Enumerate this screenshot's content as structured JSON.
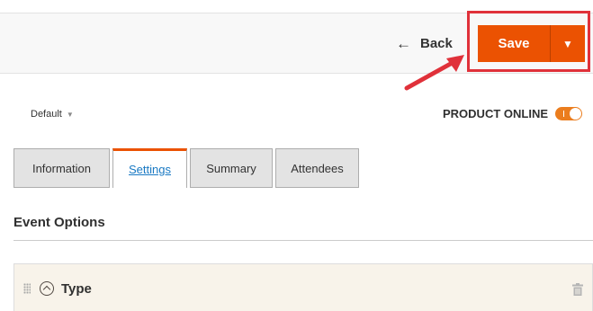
{
  "header": {
    "back_label": "Back",
    "save_label": "Save",
    "save_menu_icon": "caret-down-icon",
    "accent_color": "#eb5202",
    "highlight_color": "#e0313a"
  },
  "store": {
    "scope_label": "Default"
  },
  "status": {
    "online_label": "PRODUCT ONLINE",
    "online_enabled": true
  },
  "tabs": [
    {
      "label": "Information",
      "active": false
    },
    {
      "label": "Settings",
      "active": true
    },
    {
      "label": "Summary",
      "active": false
    },
    {
      "label": "Attendees",
      "active": false
    }
  ],
  "section": {
    "title": "Event Options"
  },
  "option": {
    "type_label": "Type"
  }
}
